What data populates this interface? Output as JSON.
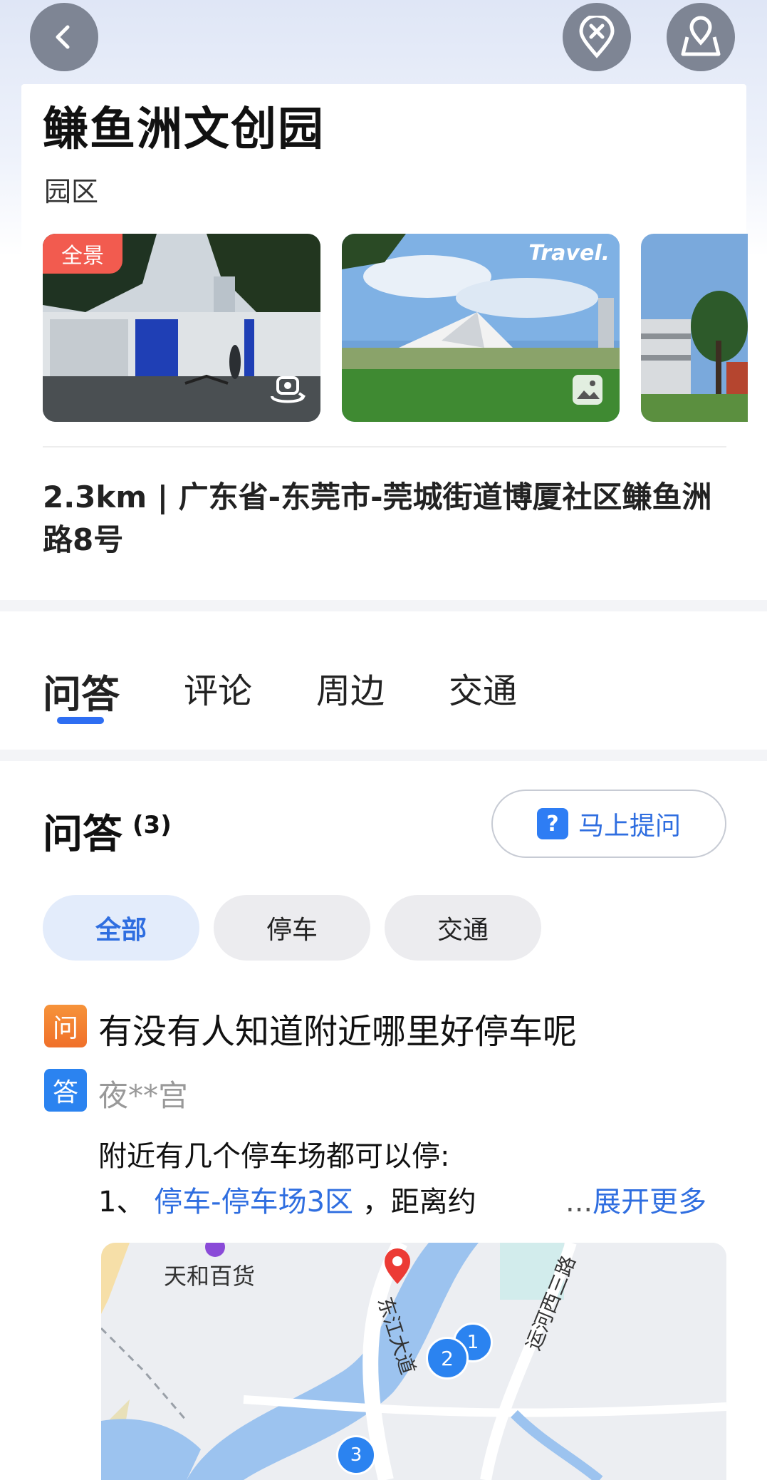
{
  "header": {
    "place_name": "鳒鱼洲文创园",
    "category": "园区",
    "panorama_badge": "全景",
    "photo2_watermark": "Travel."
  },
  "address": {
    "text": "2.3km | 广东省-东莞市-莞城街道博厦社区鳒鱼洲路8号"
  },
  "tabs": [
    {
      "label": "问答",
      "active": true
    },
    {
      "label": "评论",
      "active": false
    },
    {
      "label": "周边",
      "active": false
    },
    {
      "label": "交通",
      "active": false
    }
  ],
  "qa": {
    "title": "问答",
    "count": "(3)",
    "ask_button": "马上提问",
    "ask_icon_glyph": "?",
    "filters": [
      {
        "label": "全部",
        "active": true
      },
      {
        "label": "停车",
        "active": false
      },
      {
        "label": "交通",
        "active": false
      }
    ],
    "question_tag": "问",
    "answer_tag": "答",
    "question": "有没有人知道附近哪里好停车呢",
    "answerer": "夜**宫",
    "answer_line1": "附近有几个停车场都可以停:",
    "answer_line2_prefix": "1、",
    "answer_link": "停车-停车场3区",
    "answer_line2_suffix": "，距离约",
    "expand_dots": "...",
    "expand_label": "展开更多"
  },
  "map": {
    "poi_label": "天和百货",
    "road1": "东江大道",
    "road2": "运河西三路",
    "markers": [
      "1",
      "2",
      "3"
    ]
  },
  "icons": {
    "back": "chevron-left-icon",
    "close_pin": "location-close-icon",
    "map_pin": "map-pin-icon",
    "panorama": "panorama-icon",
    "photo": "photo-icon"
  },
  "colors": {
    "accent": "#2f6ee0",
    "badge": "#f25b4f",
    "question_tag": "#f0702a",
    "answer_tag": "#2b83f0"
  }
}
